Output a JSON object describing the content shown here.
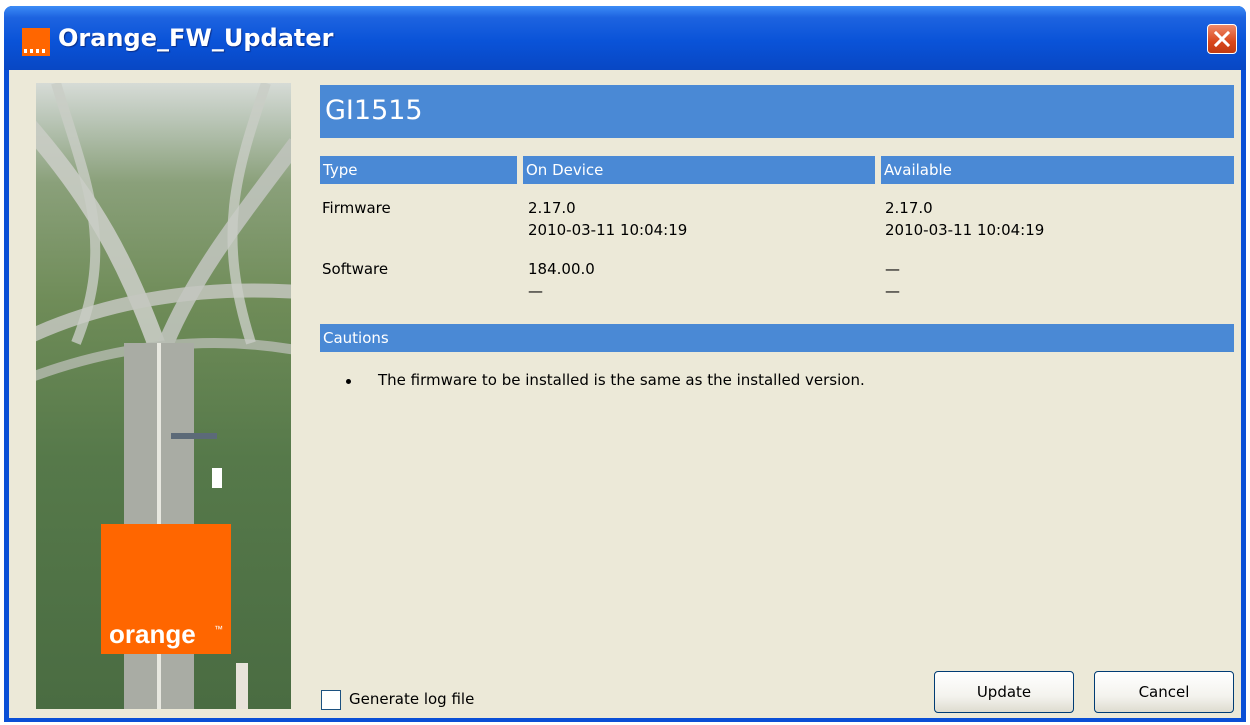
{
  "window": {
    "title": "Orange_FW_Updater",
    "close_icon": "close-icon"
  },
  "colors": {
    "title_bar": "#0a53d8",
    "header_blue": "#4a89d5",
    "client_bg": "#ece9d8",
    "brand_orange": "#ff6600"
  },
  "branding": {
    "logo_text": "orange",
    "logo_tm": "™"
  },
  "device": {
    "name": "GI1515"
  },
  "table": {
    "headers": [
      "Type",
      "On Device",
      "Available"
    ],
    "rows": [
      {
        "type": "Firmware",
        "on_device": "2.17.0\n2010-03-11 10:04:19",
        "available": "2.17.0\n2010-03-11 10:04:19"
      },
      {
        "type": "Software",
        "on_device": "184.00.0\n—",
        "available": "—\n—"
      }
    ]
  },
  "cautions": {
    "header": "Cautions",
    "items": [
      "The firmware to be installed is the same as the installed version."
    ]
  },
  "footer": {
    "checkbox_label": "Generate log file",
    "checkbox_checked": false,
    "update_label": "Update",
    "cancel_label": "Cancel"
  }
}
